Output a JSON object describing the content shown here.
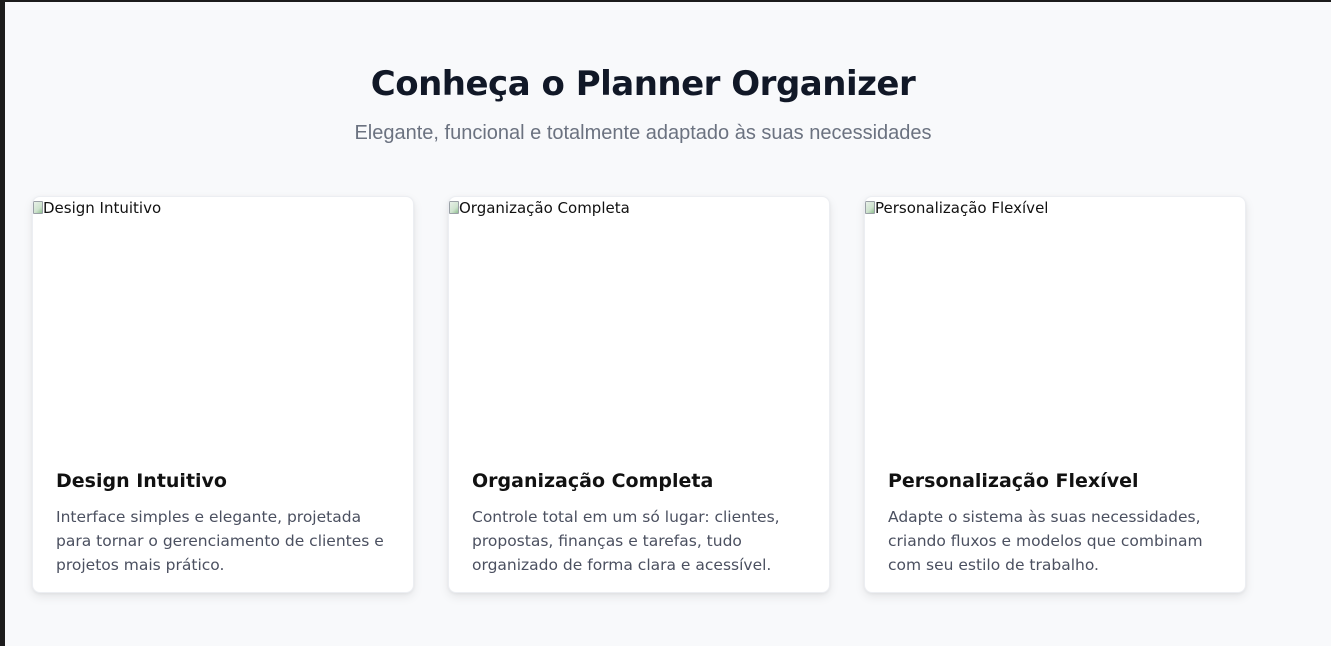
{
  "section": {
    "title": "Conheça o Planner Organizer",
    "subtitle": "Elegante, funcional e totalmente adaptado às suas necessidades"
  },
  "cards": [
    {
      "image_alt": "Design Intuitivo",
      "title": "Design Intuitivo",
      "text": "Interface simples e elegante, projetada para tornar o gerenciamento de clientes e projetos mais prático."
    },
    {
      "image_alt": "Organização Completa",
      "title": "Organização Completa",
      "text": "Controle total em um só lugar: clientes, propostas, finanças e tarefas, tudo organizado de forma clara e acessível."
    },
    {
      "image_alt": "Personalização Flexível",
      "title": "Personalização Flexível",
      "text": "Adapte o sistema às suas necessidades, criando fluxos e modelos que combinam com seu estilo de trabalho."
    }
  ],
  "colors": {
    "background": "#f8f9fb",
    "title": "#111827",
    "subtitle": "#6b7280",
    "card_background": "#ffffff",
    "card_text": "#4b5060"
  }
}
